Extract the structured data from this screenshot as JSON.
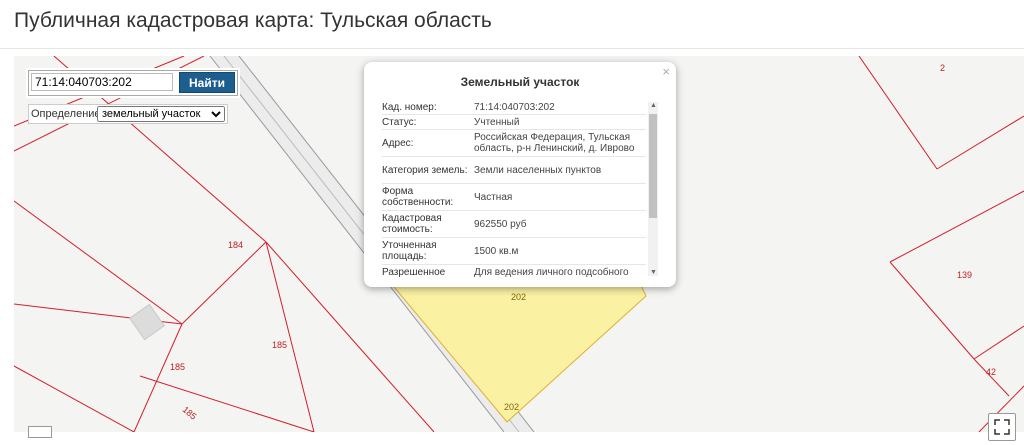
{
  "page_title": "Публичная кадастровая карта: Тульская область",
  "search": {
    "value": "71:14:040703:202",
    "button": "Найти"
  },
  "definition": {
    "label": "Определение:",
    "selected": "земельный участок"
  },
  "popup": {
    "title": "Земельный участок",
    "close": "×",
    "rows": [
      {
        "k": "Кад. номер:",
        "v": "71:14:040703:202"
      },
      {
        "k": "Статус:",
        "v": "Учтенный"
      },
      {
        "k": "Адрес:",
        "v": "Российская Федерация, Тульская область, р-н Ленинский, д. Иврово"
      },
      {
        "k": "Категория земель:",
        "v": "Земли населенных пунктов"
      },
      {
        "k": "Форма собственности:",
        "v": "Частная"
      },
      {
        "k": "Кадастровая стоимость:",
        "v": "962550 руб"
      },
      {
        "k": "Уточненная площадь:",
        "v": "1500 кв.м"
      },
      {
        "k": "Разрешенное",
        "v": "Для ведения личного подсобного"
      }
    ]
  },
  "parcel_labels": {
    "p2": "2",
    "p184": "184",
    "p185a": "185",
    "p185b": "185",
    "p185c": "185",
    "p139": "139",
    "p42": "42",
    "p202": "202",
    "p202top": "202"
  },
  "colors": {
    "parcel_line": "#d21f2c",
    "selected_fill": "#fbf1a3",
    "button": "#1e5e8e"
  }
}
